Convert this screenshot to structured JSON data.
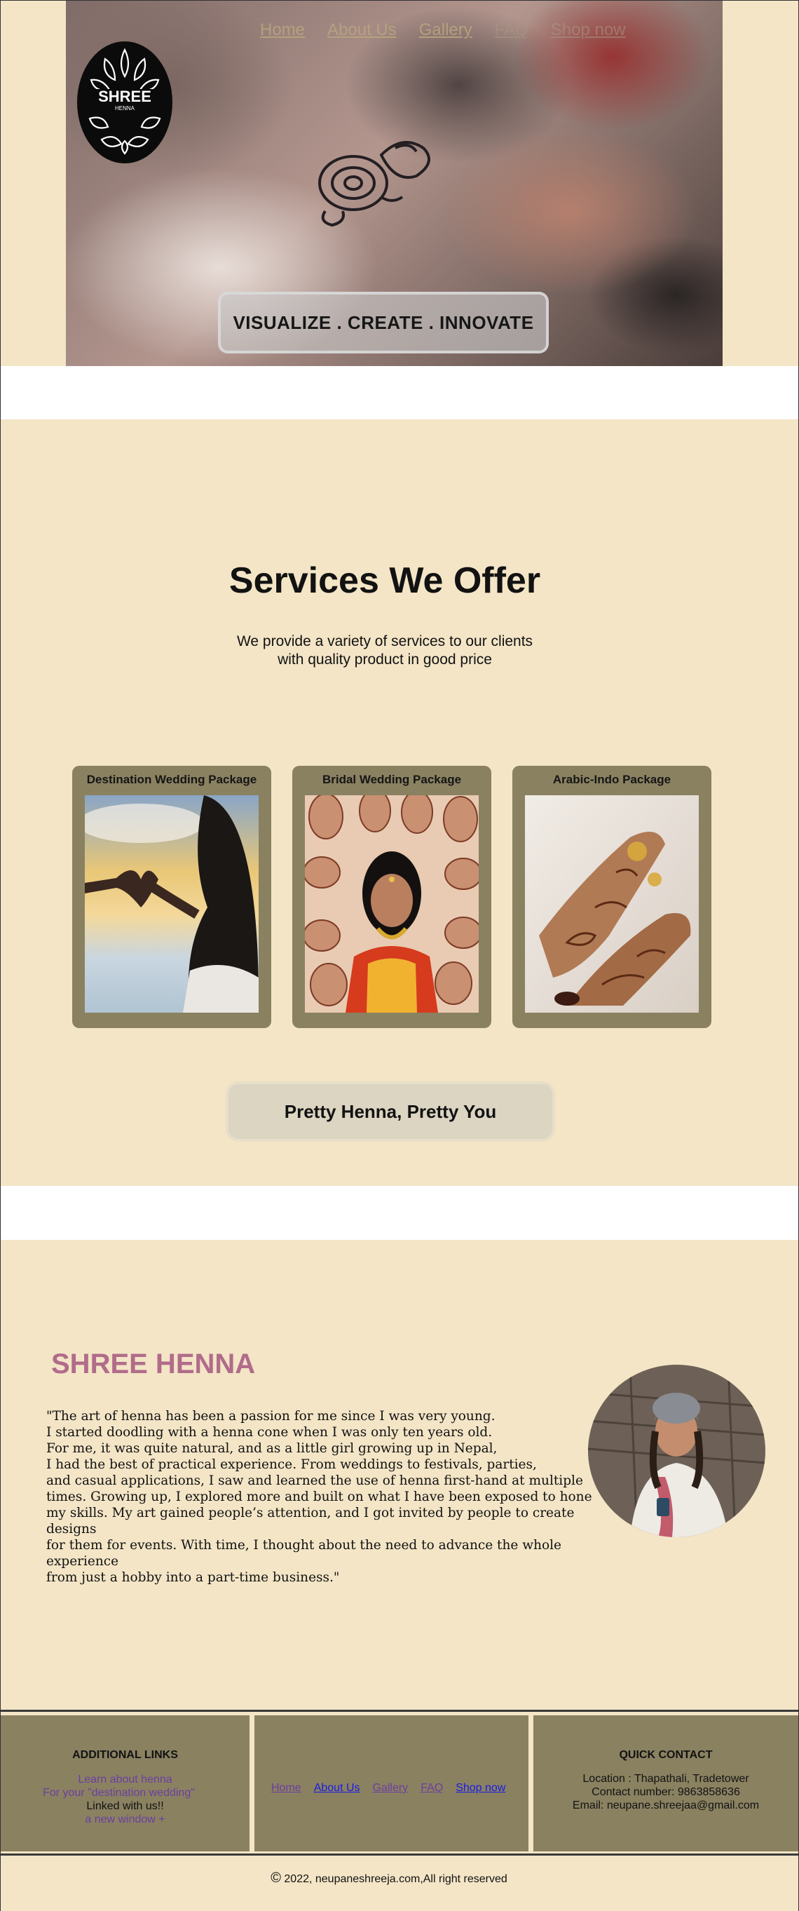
{
  "hero": {
    "nav": [
      {
        "label": "Home"
      },
      {
        "label": "About Us"
      },
      {
        "label": "Gallery"
      },
      {
        "label": "FAQ"
      },
      {
        "label": "Shop now"
      }
    ],
    "logo_text": "SHREE",
    "logo_subtext": "HENNA",
    "tagline": "VISUALIZE . CREATE . INNOVATE"
  },
  "services": {
    "title": "Services We Offer",
    "subtitle_line1": "We provide a variety of services to our clients",
    "subtitle_line2": "with quality product in good price",
    "cards": [
      {
        "title": "Destination Wedding Package"
      },
      {
        "title": "Bridal Wedding Package"
      },
      {
        "title": "Arabic-Indo Package"
      }
    ],
    "slogan": "Pretty Henna, Pretty You"
  },
  "about": {
    "title": "SHREE HENNA",
    "text": "\"The art of henna has been a passion for me since I was very young.\nI started doodling with a henna cone when I was only ten years old.\nFor me, it was quite natural, and as a little girl growing up in Nepal,\nI had the best of practical experience. From weddings to festivals, parties,\nand casual applications, I saw and learned the use of henna first-hand at multiple\n times. Growing up, I explored more and built on what I have been exposed to hone\n my skills. My art gained people’s attention, and I got invited by people to create designs\n for them for events. With time, I thought about the need to advance the whole experience\nfrom just a hobby into a part-time business.\""
  },
  "footer": {
    "additional_links": {
      "title": "ADDITIONAL LINKS",
      "line1": "Learn about henna",
      "line2": "For your \"destination wedding\"",
      "line3": "Linked with us!!",
      "line4": "a new window +"
    },
    "nav": [
      {
        "label": "Home"
      },
      {
        "label": "About Us"
      },
      {
        "label": "Gallery"
      },
      {
        "label": "FAQ"
      },
      {
        "label": "Shop now"
      }
    ],
    "quick_contact": {
      "title": "QUICK CONTACT",
      "location": "Location :  Thapathali, Tradetower",
      "phone": "Contact number: 9863858636",
      "email": "Email: neupane.shreejaa@gmail.com"
    },
    "copyright": "2022, neupaneshreeja.com,All right reserved",
    "copyright_symbol": "©"
  },
  "colors": {
    "page_bg": "#f3e5c6",
    "card_bg": "#8a8161",
    "brand_pink": "#b16c8a",
    "link_purple": "#6b3fa0",
    "link_blue": "#1a1ae6"
  }
}
